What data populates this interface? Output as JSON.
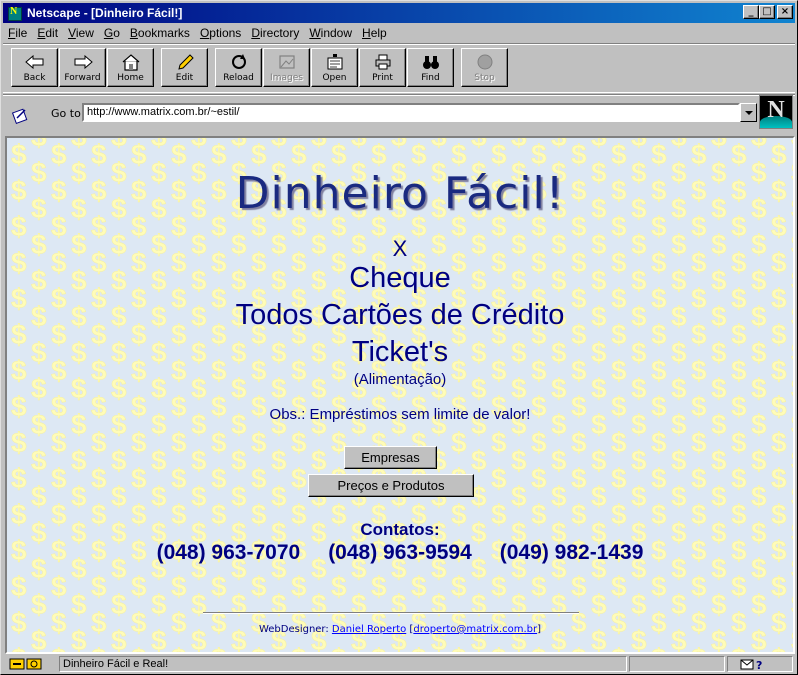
{
  "window": {
    "title": "Netscape - [Dinheiro Fácil!]",
    "controls": [
      "_",
      "□",
      "×"
    ]
  },
  "menu": [
    "File",
    "Edit",
    "View",
    "Go",
    "Bookmarks",
    "Options",
    "Directory",
    "Window",
    "Help"
  ],
  "toolbar": {
    "back": "Back",
    "forward": "Forward",
    "home": "Home",
    "edit": "Edit",
    "reload": "Reload",
    "images": "Images",
    "open": "Open",
    "print": "Print",
    "find": "Find",
    "stop": "Stop"
  },
  "location": {
    "label": "Go to:",
    "url": "http://www.matrix.com.br/~estil/"
  },
  "page": {
    "heading": "Dinheiro Fácil!",
    "x": "X",
    "cheque": "Cheque",
    "cartoes": "Todos Cartões de Crédito",
    "tickets": "Ticket's",
    "alimentacao": "(Alimentação)",
    "obs": "Obs.: Empréstimos sem limite de valor!",
    "btn_empresas": "Empresas",
    "btn_precos": "Preços e Produtos",
    "contatos": "Contatos:",
    "phones": [
      "(048) 963-7070",
      "(048) 963-9594",
      "(049) 982-1439"
    ],
    "credit_prefix": "WebDesigner: ",
    "designer": "Daniel Roperto",
    "email": "droperto@matrix.com.br"
  },
  "status": {
    "text": "Dinheiro Fácil e Real!"
  },
  "colors": {
    "text_navy": "#000080",
    "background": "#dde8f4",
    "pattern": "#fffcb8"
  }
}
